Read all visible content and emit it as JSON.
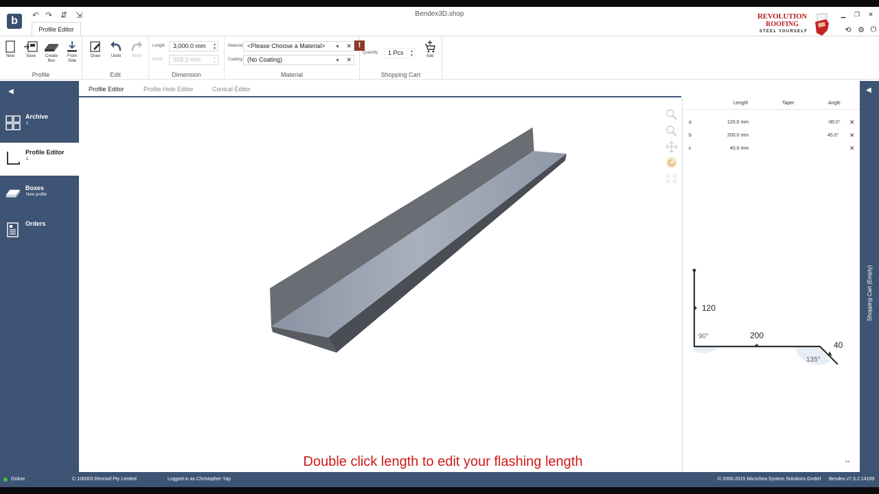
{
  "app": {
    "window_title": "Bendex3D.shop",
    "logo_letter": "b",
    "quick_access": [
      "undo-icon",
      "redo-icon",
      "profile-icon",
      "export-icon"
    ]
  },
  "brand": {
    "line1": "REVOLUTION",
    "line2": "ROOFING",
    "tagline": "STEEL YOURSELF"
  },
  "ribbon": {
    "tab": "Profile Editor",
    "groups": {
      "profile": {
        "label": "Profile",
        "new": "New",
        "save": "Save",
        "create_box": "Create Box",
        "front_side": "Front Side"
      },
      "edit": {
        "label": "Edit",
        "draw": "Draw",
        "undo": "Undo",
        "redo": "Redo"
      },
      "dimension": {
        "label": "Dimension",
        "length_label": "Length",
        "length_value": "3,000.0 mm",
        "width_label": "Width",
        "width_value": "358.3 mm"
      },
      "material": {
        "label": "Material",
        "material_label": "Material",
        "material_value": "<Please Choose a Material>",
        "coating_label": "Coating",
        "coating_value": "(No Coating)",
        "warning": "!"
      },
      "cart": {
        "label": "Shopping Cart",
        "quantity_label": "Quantity",
        "quantity_value": "1 Pcs",
        "add": "Add"
      }
    }
  },
  "sidebar": {
    "items": [
      {
        "title": "Archive",
        "sub": "1"
      },
      {
        "title": "Profile Editor",
        "sub": "1"
      },
      {
        "title": "Boxes",
        "sub": "New profile"
      },
      {
        "title": "Orders",
        "sub": ""
      }
    ]
  },
  "editor_tabs": [
    "Profile Editor",
    "Profile Hole Editor",
    "Conical Editor"
  ],
  "segments": {
    "headers": [
      "Length",
      "Taper",
      "Angle"
    ],
    "rows": [
      {
        "id": "a",
        "length": "120.0 mm",
        "taper": "",
        "angle": "-90.0°"
      },
      {
        "id": "b",
        "length": "200.0 mm",
        "taper": "",
        "angle": "45.0°"
      },
      {
        "id": "c",
        "length": "40.0 mm",
        "taper": "",
        "angle": ""
      }
    ]
  },
  "profile_2d": {
    "seg_a": "120",
    "seg_b": "200",
    "seg_c": "40",
    "angle_1": "90°",
    "angle_2": "135°"
  },
  "cart_panel": {
    "title": "Shopping Cart (Empty)"
  },
  "hint": "Double click length to edit your flashing length",
  "status": {
    "online": "Online",
    "customer": "C-100003 Revroof Pty Limited",
    "user": "Logged in as Christopher Yap",
    "copyright": "© 2006-2015 MicroSea System Solutions GmbH",
    "version": "Bendex v7.3.2.14189"
  },
  "colors": {
    "navy": "#3e5474",
    "accent_red": "#cc1a1a",
    "online_green": "#39c34a"
  }
}
